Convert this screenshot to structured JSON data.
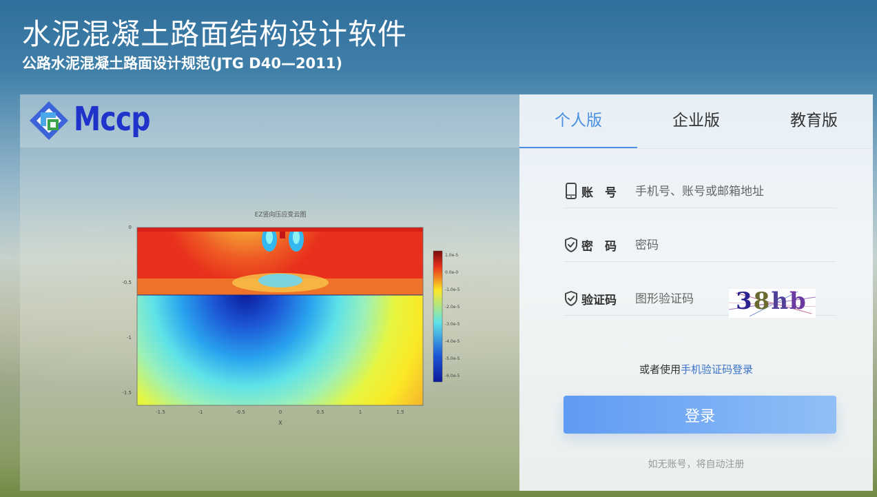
{
  "header": {
    "title": "水泥混凝土路面结构设计软件",
    "subtitle": "公路水泥混凝土路面设计规范(JTG D40—2011)"
  },
  "brand": {
    "logo_text": "Mccp"
  },
  "figure": {
    "title": "EZ竖向压应变云图",
    "xlabel": "X",
    "x_ticks": [
      "-1.5",
      "-1",
      "-0.5",
      "0",
      "0.5",
      "1",
      "1.5"
    ],
    "y_ticks": [
      "0",
      "-0.5",
      "-1",
      "-1.5"
    ],
    "colorbar_ticks": [
      "1.0e-5",
      "0.0e-0",
      "-1.0e-5",
      "-2.0e-5",
      "-3.0e-5",
      "-4.0e-5",
      "-5.0e-5",
      "-6.0e-5"
    ]
  },
  "tabs": [
    {
      "label": "个人版",
      "active": true
    },
    {
      "label": "企业版",
      "active": false
    },
    {
      "label": "教育版",
      "active": false
    }
  ],
  "form": {
    "account": {
      "label": "账　号",
      "placeholder": "手机号、账号或邮箱地址",
      "value": ""
    },
    "password": {
      "label": "密　码",
      "placeholder": "密码",
      "value": ""
    },
    "captcha": {
      "label": "验证码",
      "placeholder": "图形验证码",
      "value": "",
      "image_text": "38hb"
    },
    "alt_login_prefix": "或者使用",
    "alt_login_link": "手机验证码登录",
    "submit_label": "登录",
    "hint": "如无账号，将自动注册"
  },
  "colors": {
    "accent": "#4a90e2",
    "button_start": "#5f9bf3",
    "button_end": "#91bff7",
    "logo_blue": "#1f32c9"
  },
  "icons": {
    "account": "phone-icon",
    "password": "shield-check-icon",
    "captcha": "shield-check-icon"
  }
}
